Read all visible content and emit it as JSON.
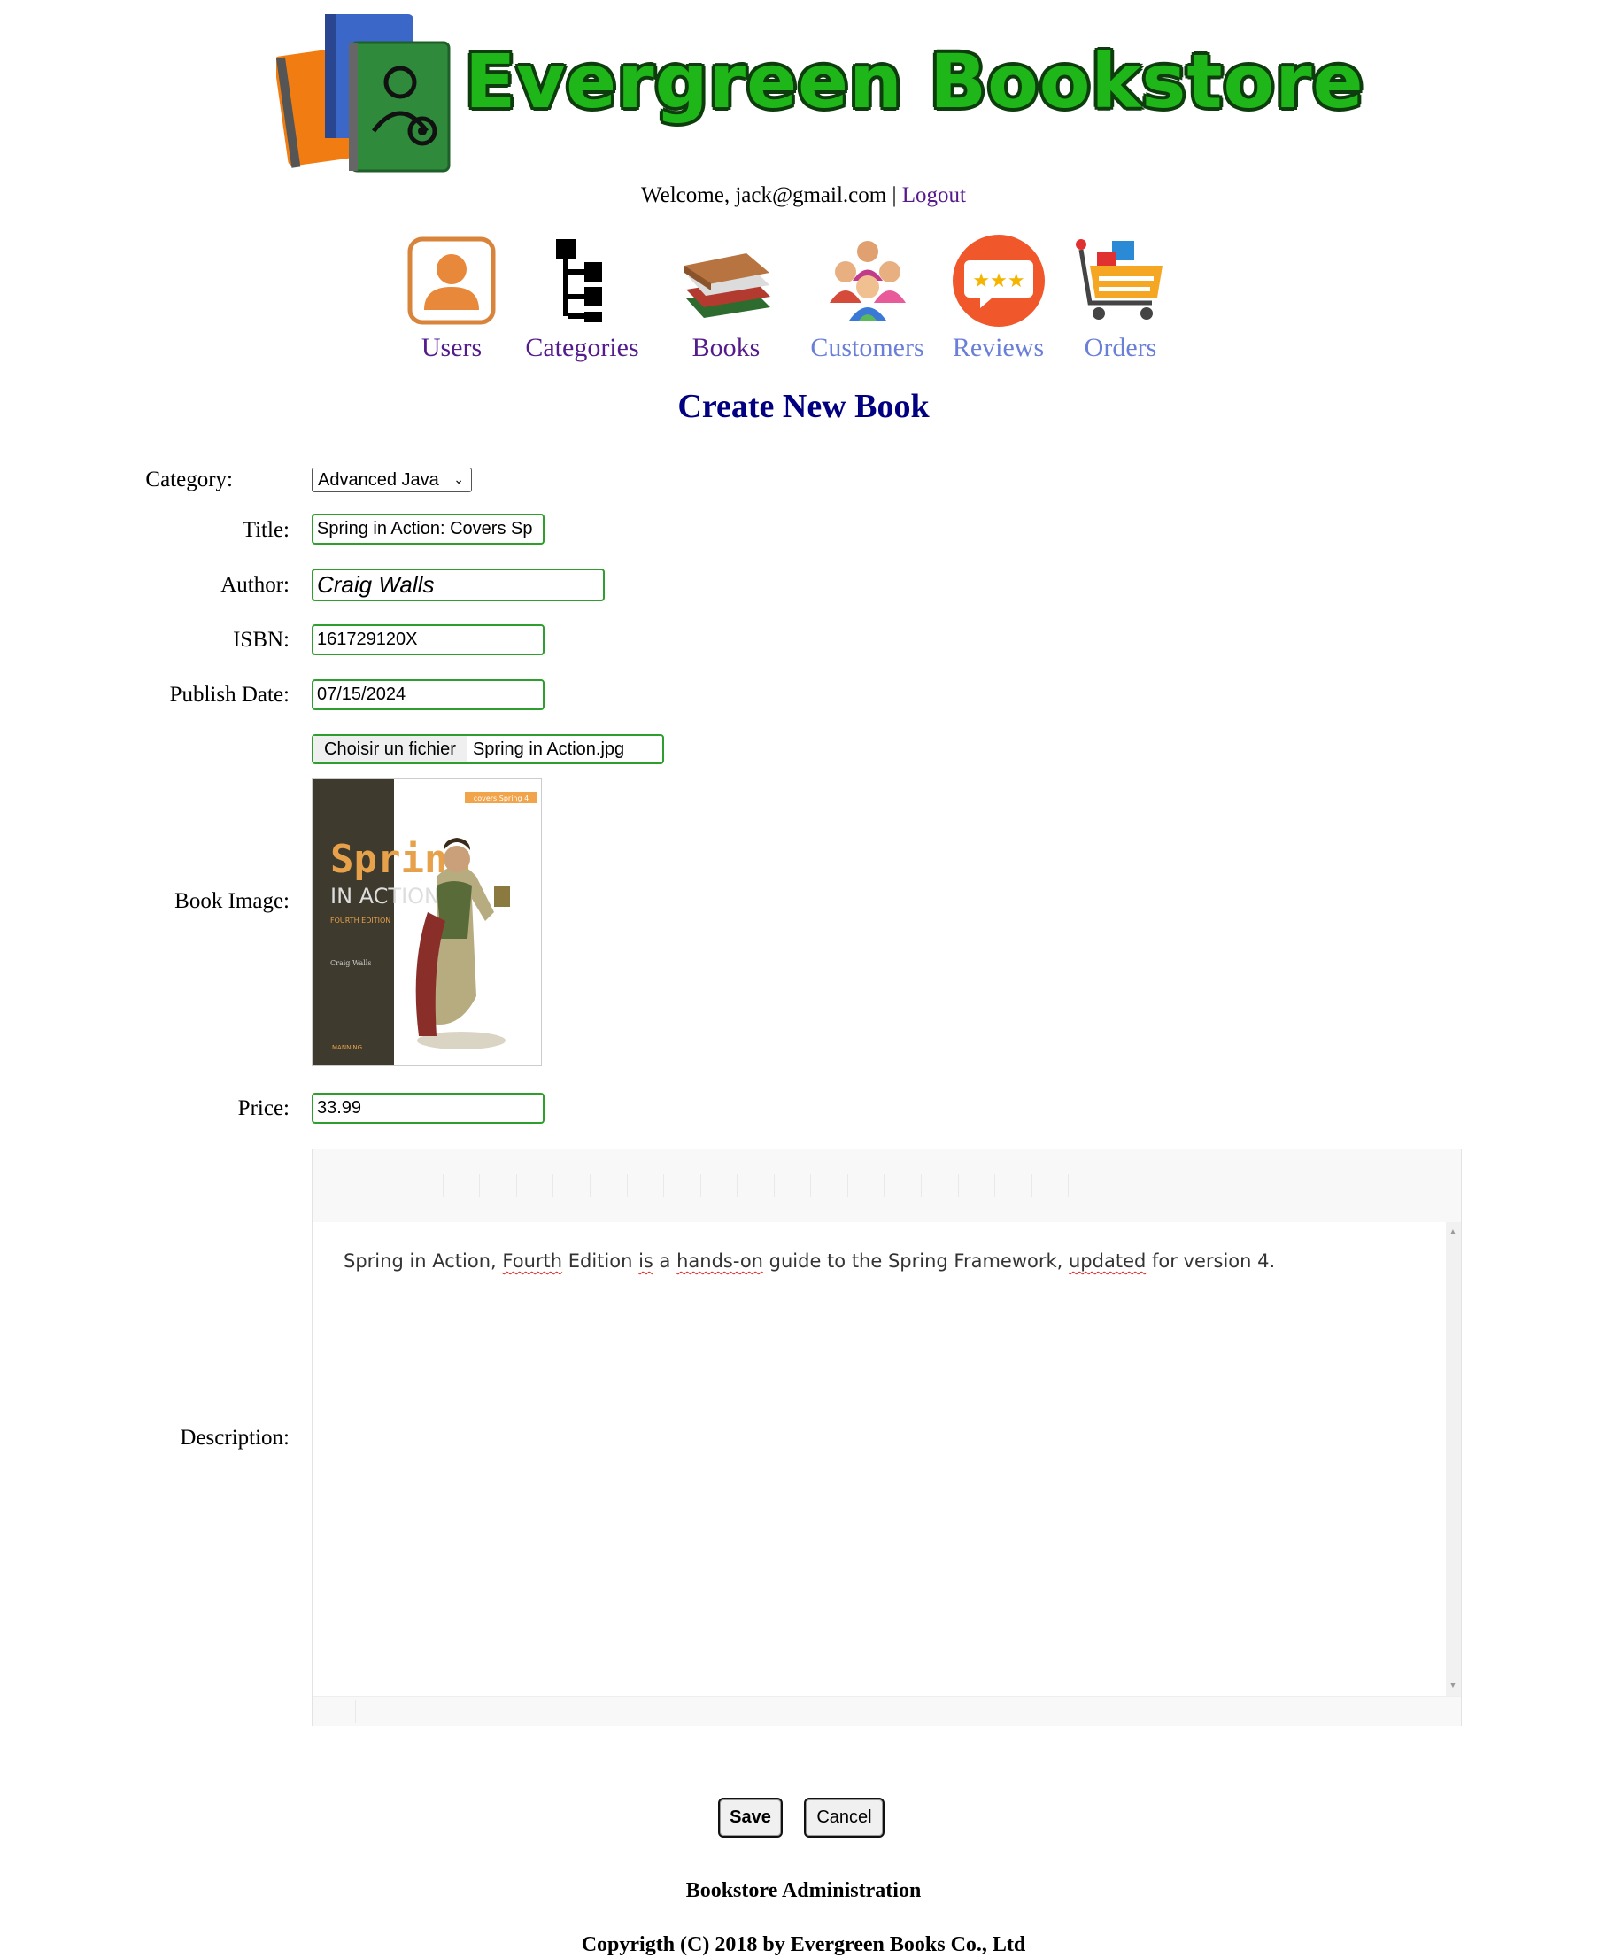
{
  "header": {
    "logo_text": "Evergreen Bookstore",
    "welcome_prefix": "Welcome, jack@gmail.com",
    "separator": "|",
    "logout_label": "Logout"
  },
  "nav": {
    "items": [
      {
        "label": "Users",
        "icon": "user-icon",
        "visited": true
      },
      {
        "label": "Categories",
        "icon": "tree-hierarchy-icon",
        "visited": true
      },
      {
        "label": "Books",
        "icon": "books-stack-icon",
        "visited": true
      },
      {
        "label": "Customers",
        "icon": "people-group-icon",
        "visited": false
      },
      {
        "label": "Reviews",
        "icon": "star-rating-bubble-icon",
        "visited": false
      },
      {
        "label": "Orders",
        "icon": "shopping-cart-icon",
        "visited": false
      }
    ]
  },
  "page": {
    "title": "Create New Book"
  },
  "form": {
    "category_label": "Category:",
    "category_value": "Advanced Java",
    "title_label": "Title:",
    "title_value": "Spring in Action: Covers Sp",
    "author_label": "Author:",
    "author_value": "Craig Walls",
    "isbn_label": "ISBN:",
    "isbn_value": "161729120X",
    "publish_date_label": "Publish Date:",
    "publish_date_value": "07/15/2024",
    "file_button_label": "Choisir un fichier",
    "file_name": "Spring in Action.jpg",
    "book_image_label": "Book Image:",
    "cover": {
      "title_line1": "Spring",
      "title_line2": "IN ACTION",
      "edition": "FOURTH EDITION",
      "author": "Craig Walls",
      "badge": "covers Spring 4",
      "publisher": "MANNING"
    },
    "price_label": "Price:",
    "price_value": "33.99",
    "description_label": "Description:",
    "description_parts": [
      "Spring in Action, ",
      "Fourth",
      " Edition ",
      "is",
      " a ",
      "hands-on",
      " guide to the Spring Framework, ",
      "updated",
      " for version 4."
    ],
    "save_label": "Save",
    "cancel_label": "Cancel"
  },
  "footer": {
    "line1": "Bookstore Administration",
    "line2": "Copyrigth (C) 2018 by Evergreen Books Co., Ltd"
  },
  "colors": {
    "visited_link": "#551a8b",
    "unvisited_link": "#6a7fd8",
    "title": "#000080",
    "input_border": "#2e9e2e",
    "logo_green": "#1fb61a"
  }
}
